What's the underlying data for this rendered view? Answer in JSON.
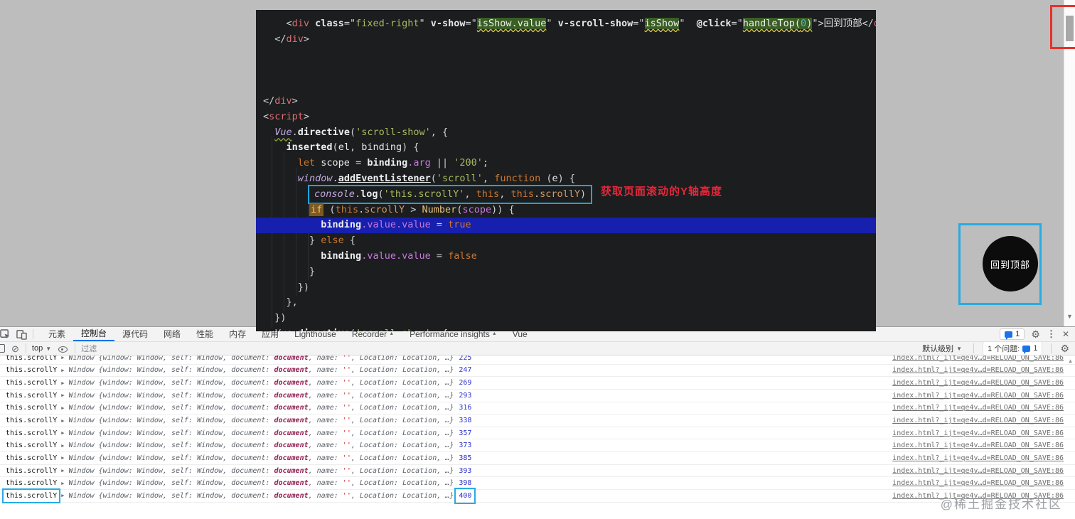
{
  "annotations": {
    "scroll_tip": "获取页面滚动的Y轴高度"
  },
  "overlay": {
    "back_to_top": "回到顶部",
    "watermark": "@稀土掘金技术社区"
  },
  "colors": {
    "annotation_cyan": "#29abe2",
    "annotation_red": "#e8312a",
    "selection_blue": "#161fae",
    "active_tab_blue": "#1a73e8"
  },
  "editor": {
    "lines": [
      {
        "s": [
          [
            "pun",
            "    <"
          ],
          [
            "tag",
            "div"
          ],
          [
            "pun",
            " "
          ],
          [
            "attr",
            "class"
          ],
          [
            "pun",
            "=\""
          ],
          [
            "str",
            "fixed-right"
          ],
          [
            "pun",
            "\" "
          ],
          [
            "attr",
            "v-show"
          ],
          [
            "pun",
            "=\""
          ],
          [
            "hl",
            "isShow.value"
          ],
          [
            "pun",
            "\" "
          ],
          [
            "attr",
            "v-scroll-show"
          ],
          [
            "pun",
            "=\""
          ],
          [
            "hl",
            "isShow"
          ],
          [
            "pun",
            "\"  "
          ],
          [
            "attr",
            "@click"
          ],
          [
            "pun",
            "=\""
          ],
          [
            "hl",
            "handleTop("
          ],
          [
            "hlnum",
            "0"
          ],
          [
            "hl",
            ")"
          ],
          [
            "pun",
            "\">"
          ],
          [
            "txt",
            "回到顶部"
          ],
          [
            "pun",
            "</"
          ],
          [
            "tag",
            "div"
          ],
          [
            "pun",
            ">"
          ]
        ]
      },
      {
        "s": [
          [
            "pun",
            "  </"
          ],
          [
            "tag",
            "div"
          ],
          [
            "pun",
            ">"
          ]
        ]
      },
      {
        "s": []
      },
      {
        "s": []
      },
      {
        "s": []
      },
      {
        "s": [
          [
            "pun",
            "</"
          ],
          [
            "tag",
            "div"
          ],
          [
            "pun",
            ">"
          ]
        ]
      },
      {
        "s": [
          [
            "pun",
            "<"
          ],
          [
            "tag",
            "script"
          ],
          [
            "pun",
            ">"
          ]
        ]
      },
      {
        "s": [
          [
            "pun",
            "  "
          ],
          [
            "globu",
            "Vue"
          ],
          [
            "pun",
            "."
          ],
          [
            "fn",
            "directive"
          ],
          [
            "pun",
            "("
          ],
          [
            "str",
            "'scroll-show'"
          ],
          [
            "pun",
            ", {"
          ]
        ]
      },
      {
        "s": [
          [
            "pun",
            "    "
          ],
          [
            "fn",
            "inserted"
          ],
          [
            "pun",
            "("
          ],
          [
            "txt",
            "el"
          ],
          [
            "pun",
            ", "
          ],
          [
            "txt",
            "binding"
          ],
          [
            "pun",
            ") {"
          ]
        ]
      },
      {
        "s": [
          [
            "pun",
            "      "
          ],
          [
            "kw",
            "let"
          ],
          [
            "txt",
            " scope "
          ],
          [
            "pun",
            "= "
          ],
          [
            "bld",
            "binding"
          ],
          [
            "prop",
            ".arg"
          ],
          [
            "pun",
            " || "
          ],
          [
            "str",
            "'200'"
          ],
          [
            "pun",
            ";"
          ]
        ]
      },
      {
        "s": [
          [
            "pun",
            "      "
          ],
          [
            "glob",
            "window"
          ],
          [
            "pun",
            "."
          ],
          [
            "fnu",
            "addEventListener"
          ],
          [
            "pun",
            "("
          ],
          [
            "str",
            "'scroll'"
          ],
          [
            "pun",
            ", "
          ],
          [
            "kw",
            "function"
          ],
          [
            "pun",
            " ("
          ],
          [
            "txt",
            "e"
          ],
          [
            "pun",
            ") {"
          ]
        ]
      },
      {
        "box": true,
        "s": [
          [
            "pun",
            "        "
          ],
          [
            "glob",
            "console"
          ],
          [
            "pun",
            "."
          ],
          [
            "bld",
            "log"
          ],
          [
            "pun",
            "("
          ],
          [
            "str",
            "'this.scrollY'"
          ],
          [
            "pun",
            ", "
          ],
          [
            "kw",
            "this"
          ],
          [
            "pun",
            ", "
          ],
          [
            "kw",
            "this"
          ],
          [
            "pun",
            "."
          ],
          [
            "propo",
            "scrollY"
          ],
          [
            "pun",
            ")"
          ]
        ]
      },
      {
        "s": [
          [
            "pun",
            "        "
          ],
          [
            "kwbox",
            "if"
          ],
          [
            "pun",
            " ("
          ],
          [
            "kw",
            "this"
          ],
          [
            "pun",
            "."
          ],
          [
            "propo",
            "scrollY"
          ],
          [
            "pun",
            " > "
          ],
          [
            "numy",
            "Number"
          ],
          [
            "pun",
            "("
          ],
          [
            "prop",
            "scope"
          ],
          [
            "pun",
            ")) {"
          ]
        ]
      },
      {
        "sel": true,
        "s": [
          [
            "pun",
            "          "
          ],
          [
            "bld",
            "binding"
          ],
          [
            "prop",
            ".value.value"
          ],
          [
            "pun",
            " = "
          ],
          [
            "kw",
            "true"
          ]
        ]
      },
      {
        "s": [
          [
            "pun",
            "        } "
          ],
          [
            "kw",
            "else"
          ],
          [
            "pun",
            " {"
          ]
        ]
      },
      {
        "sA": 1,
        "s": [
          [
            "pun",
            "          "
          ],
          [
            "bld",
            "binding"
          ],
          [
            "prop",
            ".value.value"
          ],
          [
            "pun",
            " = "
          ],
          [
            "kw",
            "false"
          ]
        ]
      },
      {
        "s": [
          [
            "pun",
            "        }"
          ]
        ]
      },
      {
        "s": [
          [
            "pun",
            "      })"
          ]
        ]
      },
      {
        "s": [
          [
            "pun",
            "    },"
          ]
        ]
      },
      {
        "s": [
          [
            "pun",
            "  })"
          ]
        ]
      },
      {
        "cut": true,
        "s": [
          [
            "pun",
            "  "
          ],
          [
            "globu",
            "Vue"
          ],
          [
            "pun",
            "."
          ],
          [
            "fn",
            "directive"
          ],
          [
            "pun",
            "("
          ],
          [
            "str",
            "'scroll-show'"
          ],
          [
            "pun",
            ", {"
          ]
        ]
      }
    ]
  },
  "devtools": {
    "tabs": [
      {
        "label": "元素"
      },
      {
        "label": "控制台",
        "active": true
      },
      {
        "label": "源代码"
      },
      {
        "label": "网络"
      },
      {
        "label": "性能"
      },
      {
        "label": "内存"
      },
      {
        "label": "应用"
      },
      {
        "label": "Lighthouse"
      },
      {
        "label": "Recorder",
        "warn": true
      },
      {
        "label": "Performance insights",
        "warn": true
      },
      {
        "label": "Vue"
      }
    ],
    "tabbar_right": {
      "issues_count": "1"
    },
    "toolbar": {
      "context": "top",
      "filter_placeholder": "过滤",
      "default_level": "默认级别",
      "issue_text": "1 个问题:",
      "issue_count": "1"
    },
    "console": {
      "label": "this.scrollY",
      "preview": [
        [
          "pv",
          "Window {window: Window, self: Window, document: "
        ],
        [
          "pvdoc",
          "document"
        ],
        [
          "pv",
          ", name: "
        ],
        [
          "pvstr",
          "''"
        ],
        [
          "pv",
          ", Location: Location, …}"
        ]
      ],
      "values": [
        225,
        247,
        269,
        293,
        316,
        338,
        357,
        373,
        385,
        393,
        398,
        400
      ],
      "link": "index.html?_ijt=qe4v…d=RELOAD_ON_SAVE:86"
    }
  }
}
